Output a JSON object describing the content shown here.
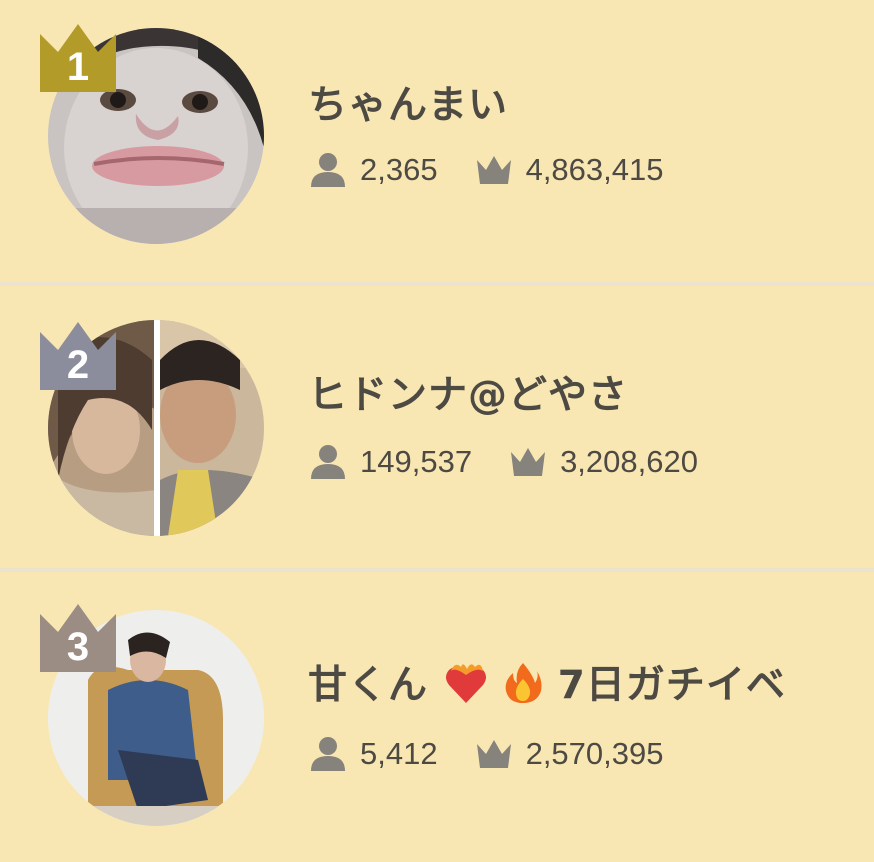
{
  "colors": {
    "background": "#f9e7b3",
    "divider": "#ece3cf",
    "text": "#4d4a44",
    "icon": "#86827c",
    "crown_gold": "#b39b2a",
    "crown_silver": "#8c8d9c",
    "crown_bronze": "#9b8c84"
  },
  "ranking": [
    {
      "rank": "1",
      "name": "ちゃんまい",
      "followers": "2,365",
      "points": "4,863,415",
      "crown_color": "gold"
    },
    {
      "rank": "2",
      "name": "ヒドンナ@どやさ",
      "followers": "149,537",
      "points": "3,208,620",
      "crown_color": "silver"
    },
    {
      "rank": "3",
      "name_text": "甘くん",
      "name_suffix": "7日ガチイベ",
      "name_emojis": [
        "heart-on-fire-emoji",
        "fire-emoji"
      ],
      "followers": "5,412",
      "points": "2,570,395",
      "crown_color": "bronze"
    }
  ]
}
